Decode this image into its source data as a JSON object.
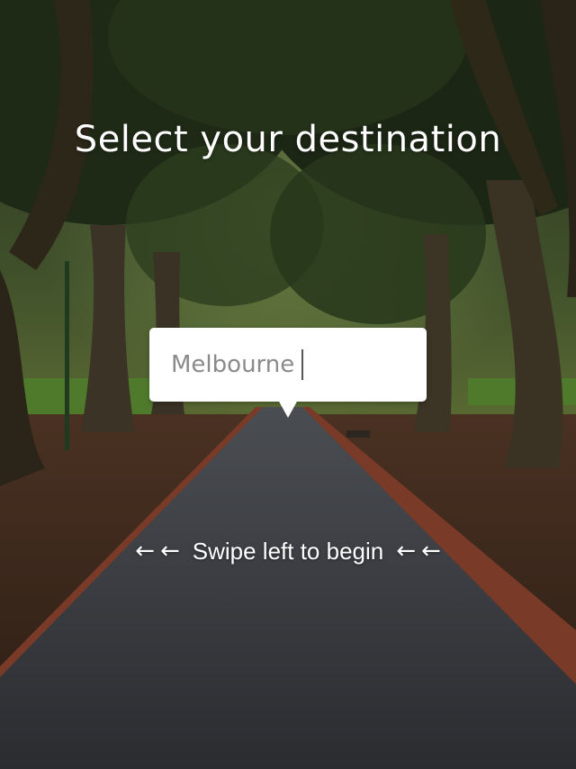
{
  "screen": {
    "title": "Select your destination",
    "destination": {
      "value": "Melbourne"
    },
    "swipe_hint": {
      "arrow": "←",
      "text": "Swipe left to begin"
    }
  },
  "background": {
    "subject": "tree-lined-park-path-photo"
  },
  "colors": {
    "text": "#ffffff",
    "input_text": "#8a8a8a",
    "bubble": "#ffffff"
  }
}
